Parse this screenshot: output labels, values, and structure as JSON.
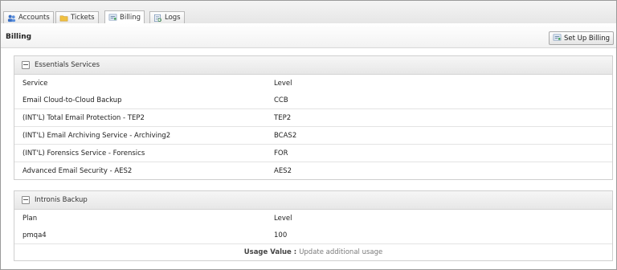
{
  "tabs": [
    {
      "label": "Accounts",
      "icon": "users-icon"
    },
    {
      "label": "Tickets",
      "icon": "folder-icon"
    },
    {
      "label": "Billing",
      "icon": "billing-icon",
      "active": true
    },
    {
      "label": "Logs",
      "icon": "logs-icon"
    }
  ],
  "header": {
    "title": "Billing",
    "setup_button": "Set Up Billing"
  },
  "essentials": {
    "title": "Essentials Services",
    "columns": {
      "service": "Service",
      "level": "Level"
    },
    "rows": [
      {
        "service": "Email Cloud-to-Cloud Backup",
        "level": "CCB"
      },
      {
        "service": "(INT'L) Total Email Protection - TEP2",
        "level": "TEP2"
      },
      {
        "service": "(INT'L) Email Archiving Service - Archiving2",
        "level": "BCAS2"
      },
      {
        "service": "(INT'L) Forensics Service - Forensics",
        "level": "FOR"
      },
      {
        "service": "Advanced Email Security - AES2",
        "level": "AES2"
      }
    ]
  },
  "intronis": {
    "title": "Intronis Backup",
    "columns": {
      "plan": "Plan",
      "level": "Level"
    },
    "rows": [
      {
        "plan": "pmqa4",
        "level": "100"
      }
    ],
    "usage_label": "Usage Value :",
    "usage_link": "Update additional usage"
  },
  "colors": {
    "border": "#cfcfcf",
    "header_bg": "#e7e7e7",
    "link": "#7a7a7a"
  }
}
